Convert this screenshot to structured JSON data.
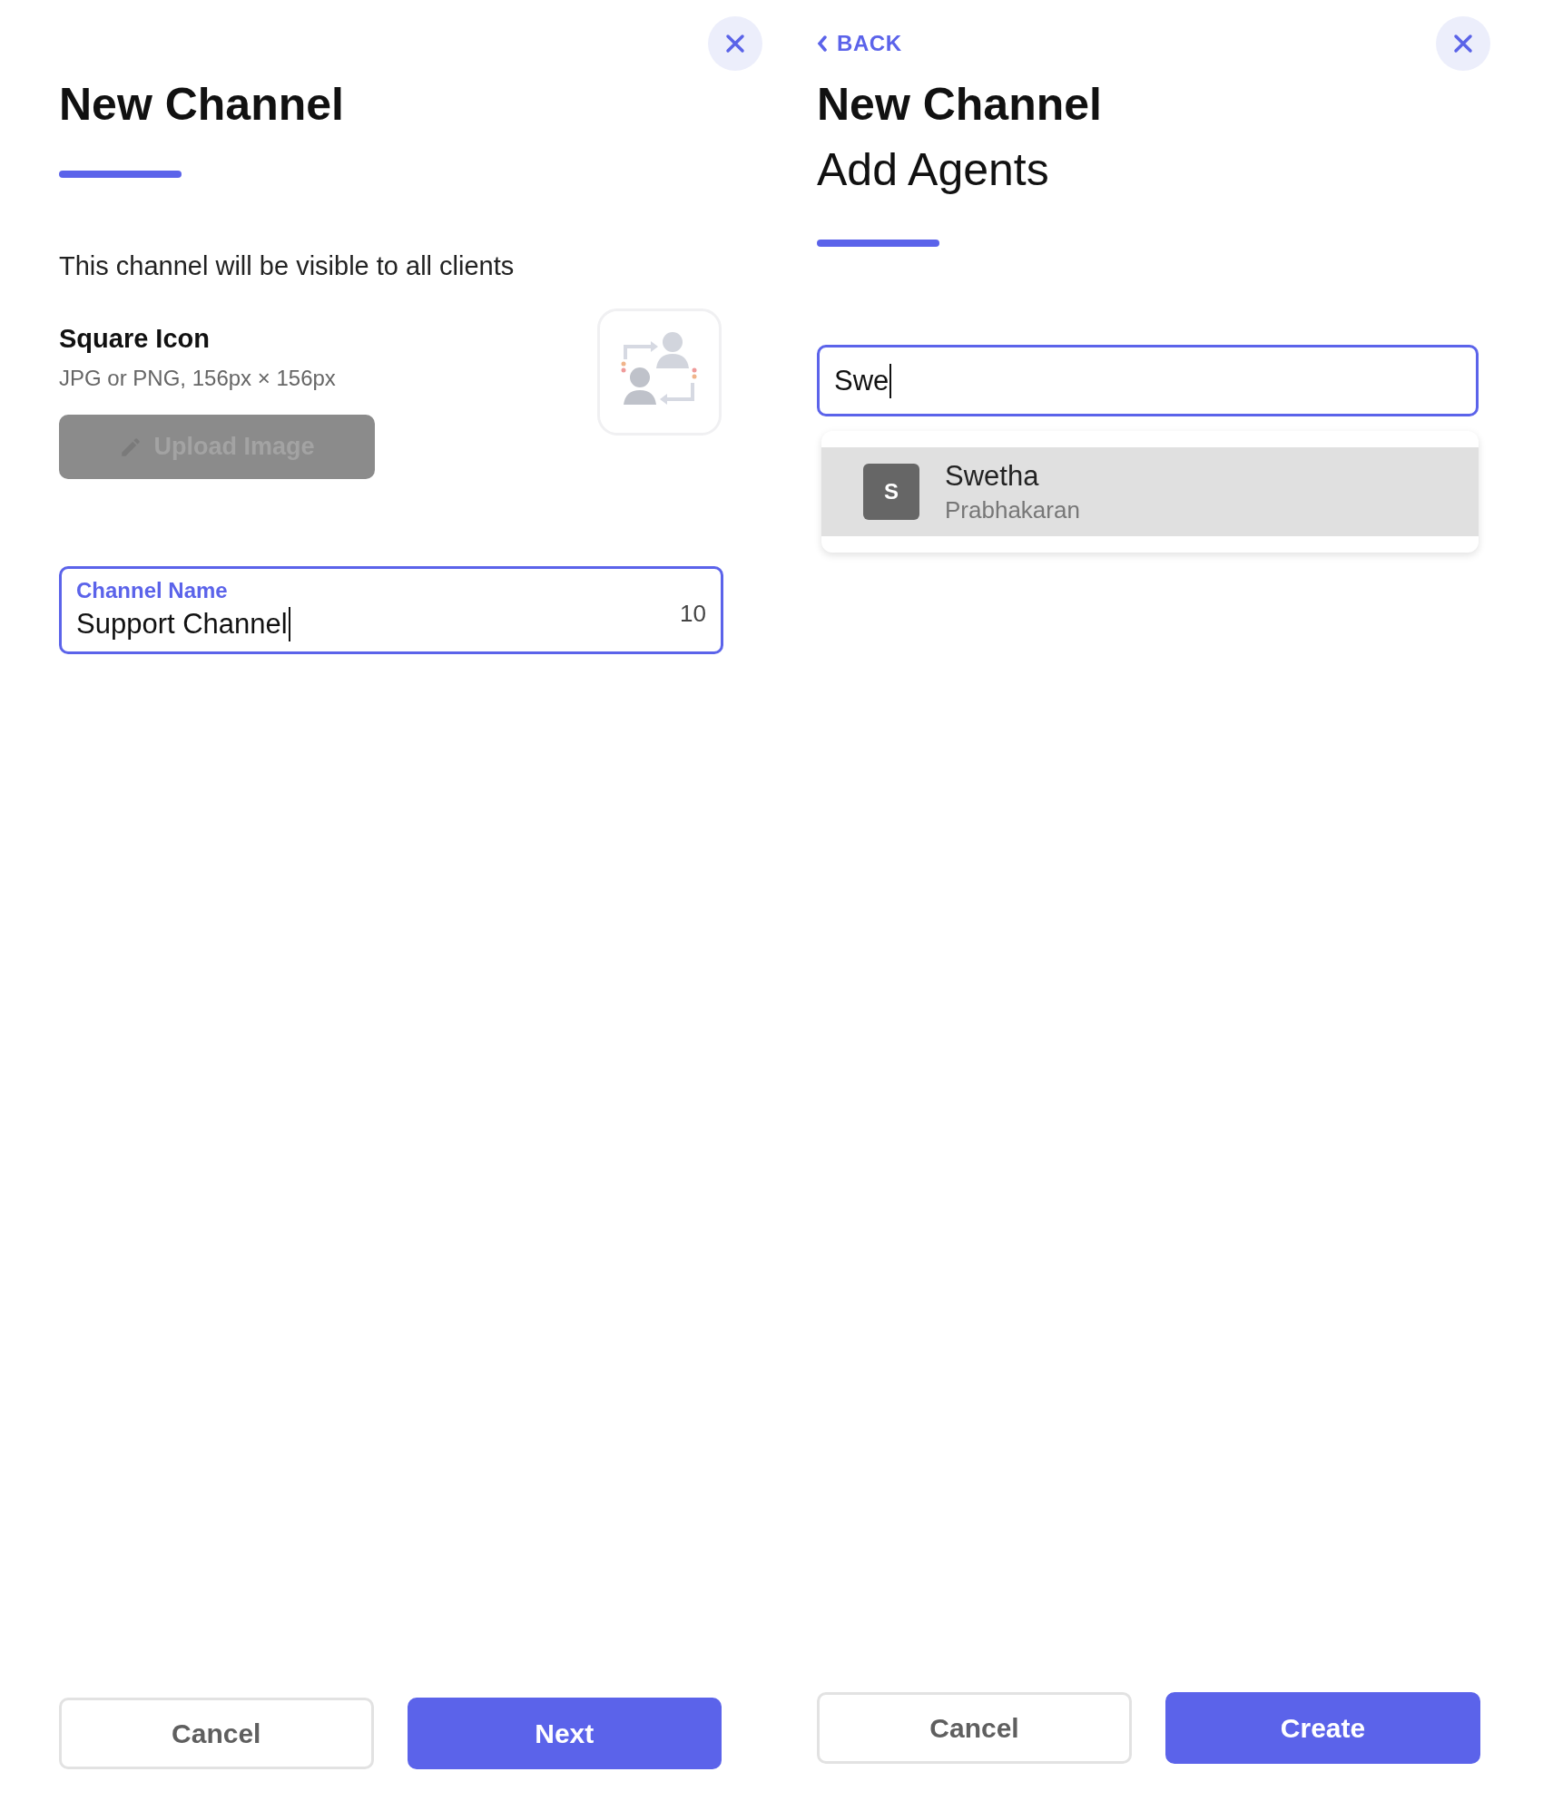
{
  "panels": [
    {
      "kind": "details",
      "title": "New Channel",
      "description": "This channel will be visible to all clients",
      "icon_section": {
        "label": "Square Icon",
        "hint": "JPG or PNG, 156px × 156px",
        "upload_button": {
          "label": "Upload Image",
          "disabled": true
        }
      },
      "channel_field": {
        "label": "Channel Name",
        "value": "Support Channel",
        "counter": "10"
      },
      "buttons": [
        {
          "label": "Cancel",
          "kind": "secondary"
        },
        {
          "label": "Next",
          "kind": "primary"
        }
      ]
    },
    {
      "kind": "agents",
      "back": "BACK",
      "title": "New Channel",
      "subtitle": "Add Agents",
      "search": {
        "value": "Swe"
      },
      "results": [
        {
          "initial": "S",
          "first_name": "Swetha",
          "last_name": "Prabhakaran",
          "selected": true
        }
      ],
      "buttons": [
        {
          "label": "Cancel",
          "kind": "secondary"
        },
        {
          "label": "Create",
          "kind": "primary"
        }
      ]
    }
  ]
}
